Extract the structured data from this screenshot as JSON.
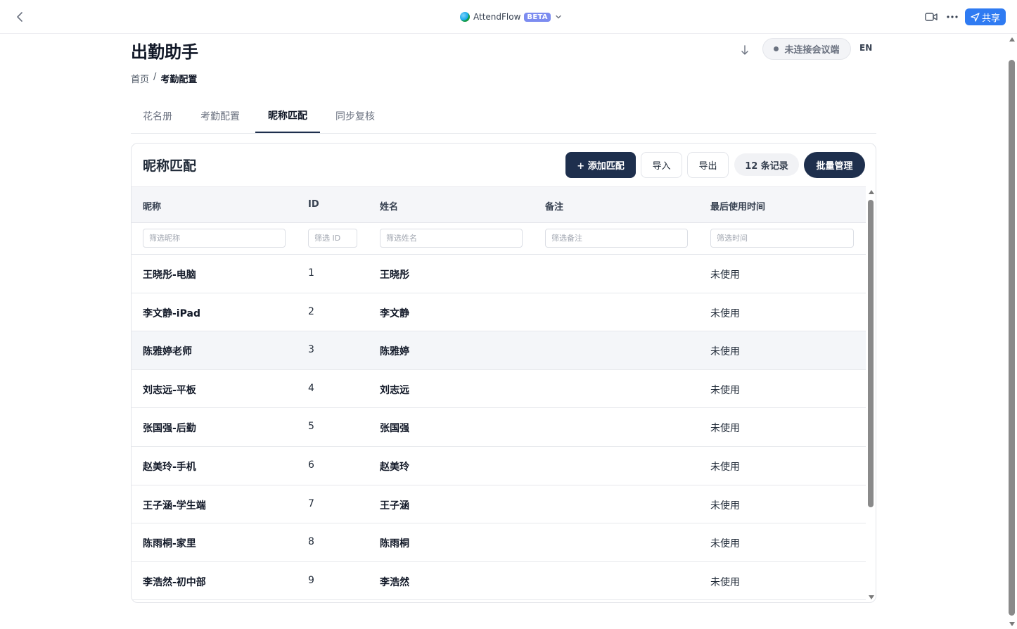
{
  "window": {
    "app_name": "AttendFlow",
    "beta_label": "BETA",
    "share_label": "共享"
  },
  "header": {
    "title": "出勤助手",
    "connection_status": "未连接会议端",
    "lang_toggle": "EN"
  },
  "breadcrumb": {
    "home": "首页",
    "separator": "/",
    "current": "考勤配置"
  },
  "tabs": [
    {
      "label": "花名册",
      "active": false
    },
    {
      "label": "考勤配置",
      "active": false
    },
    {
      "label": "昵称匹配",
      "active": true
    },
    {
      "label": "同步复核",
      "active": false
    }
  ],
  "card": {
    "title": "昵称匹配",
    "add_label": "+ 添加匹配",
    "import_label": "导入",
    "export_label": "导出",
    "record_count": "12 条记录",
    "batch_label": "批量管理"
  },
  "table": {
    "columns": [
      "昵称",
      "ID",
      "姓名",
      "备注",
      "最后使用时间"
    ],
    "filters": [
      "筛选昵称",
      "筛选 ID",
      "筛选姓名",
      "筛选备注",
      "筛选时间"
    ],
    "rows": [
      {
        "nickname": "王晓彤-电脑",
        "id": "1",
        "name": "王晓彤",
        "note": "",
        "last_used": "未使用"
      },
      {
        "nickname": "李文静-iPad",
        "id": "2",
        "name": "李文静",
        "note": "",
        "last_used": "未使用"
      },
      {
        "nickname": "陈雅婷老师",
        "id": "3",
        "name": "陈雅婷",
        "note": "",
        "last_used": "未使用"
      },
      {
        "nickname": "刘志远-平板",
        "id": "4",
        "name": "刘志远",
        "note": "",
        "last_used": "未使用"
      },
      {
        "nickname": "张国强-后勤",
        "id": "5",
        "name": "张国强",
        "note": "",
        "last_used": "未使用"
      },
      {
        "nickname": "赵美玲-手机",
        "id": "6",
        "name": "赵美玲",
        "note": "",
        "last_used": "未使用"
      },
      {
        "nickname": "王子涵-学生端",
        "id": "7",
        "name": "王子涵",
        "note": "",
        "last_used": "未使用"
      },
      {
        "nickname": "陈雨桐-家里",
        "id": "8",
        "name": "陈雨桐",
        "note": "",
        "last_used": "未使用"
      },
      {
        "nickname": "李浩然-初中部",
        "id": "9",
        "name": "李浩然",
        "note": "",
        "last_used": "未使用"
      }
    ],
    "highlighted_row": 3
  },
  "colors": {
    "primary": "#1e2f4d",
    "share_blue": "#2f7bf2",
    "beta_purple": "#7c8cf0"
  }
}
